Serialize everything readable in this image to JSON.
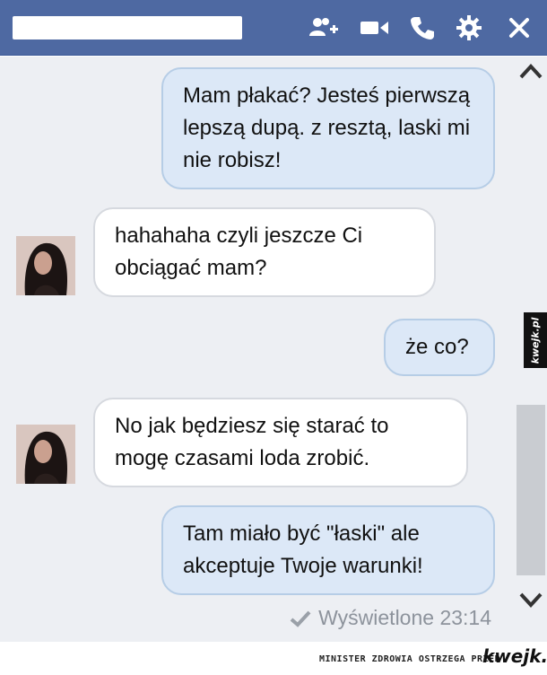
{
  "header": {
    "contact_name": "",
    "icons": [
      "add-person-icon",
      "video-call-icon",
      "phone-icon",
      "gear-icon",
      "close-icon"
    ]
  },
  "messages": [
    {
      "direction": "out",
      "text": "Mam płakać? Jesteś pierwszą lepszą dupą. z resztą, laski mi nie robisz!"
    },
    {
      "direction": "in",
      "text": "hahahaha czyli jeszcze Ci obciągać mam?"
    },
    {
      "direction": "out",
      "text": "że co?"
    },
    {
      "direction": "in",
      "text": "No jak będziesz się starać to mogę czasami loda zrobić."
    },
    {
      "direction": "out",
      "text": "Tam miało być \"łaski\" ale akceptuje Twoje warunki!"
    }
  ],
  "seen": {
    "label": "Wyświetlone 23:14",
    "icon": "checkmark-icon"
  },
  "footer": {
    "warning": "MINISTER ZDROWIA OSTRZEGA PRZED",
    "logo": "kwejk.pl"
  },
  "side_badge": {
    "text": "kwejk.pl"
  },
  "colors": {
    "header_bg": "#4e69a2",
    "chat_bg": "#edeff3",
    "outgoing_bubble": "#dce8f7",
    "incoming_bubble": "#ffffff"
  }
}
